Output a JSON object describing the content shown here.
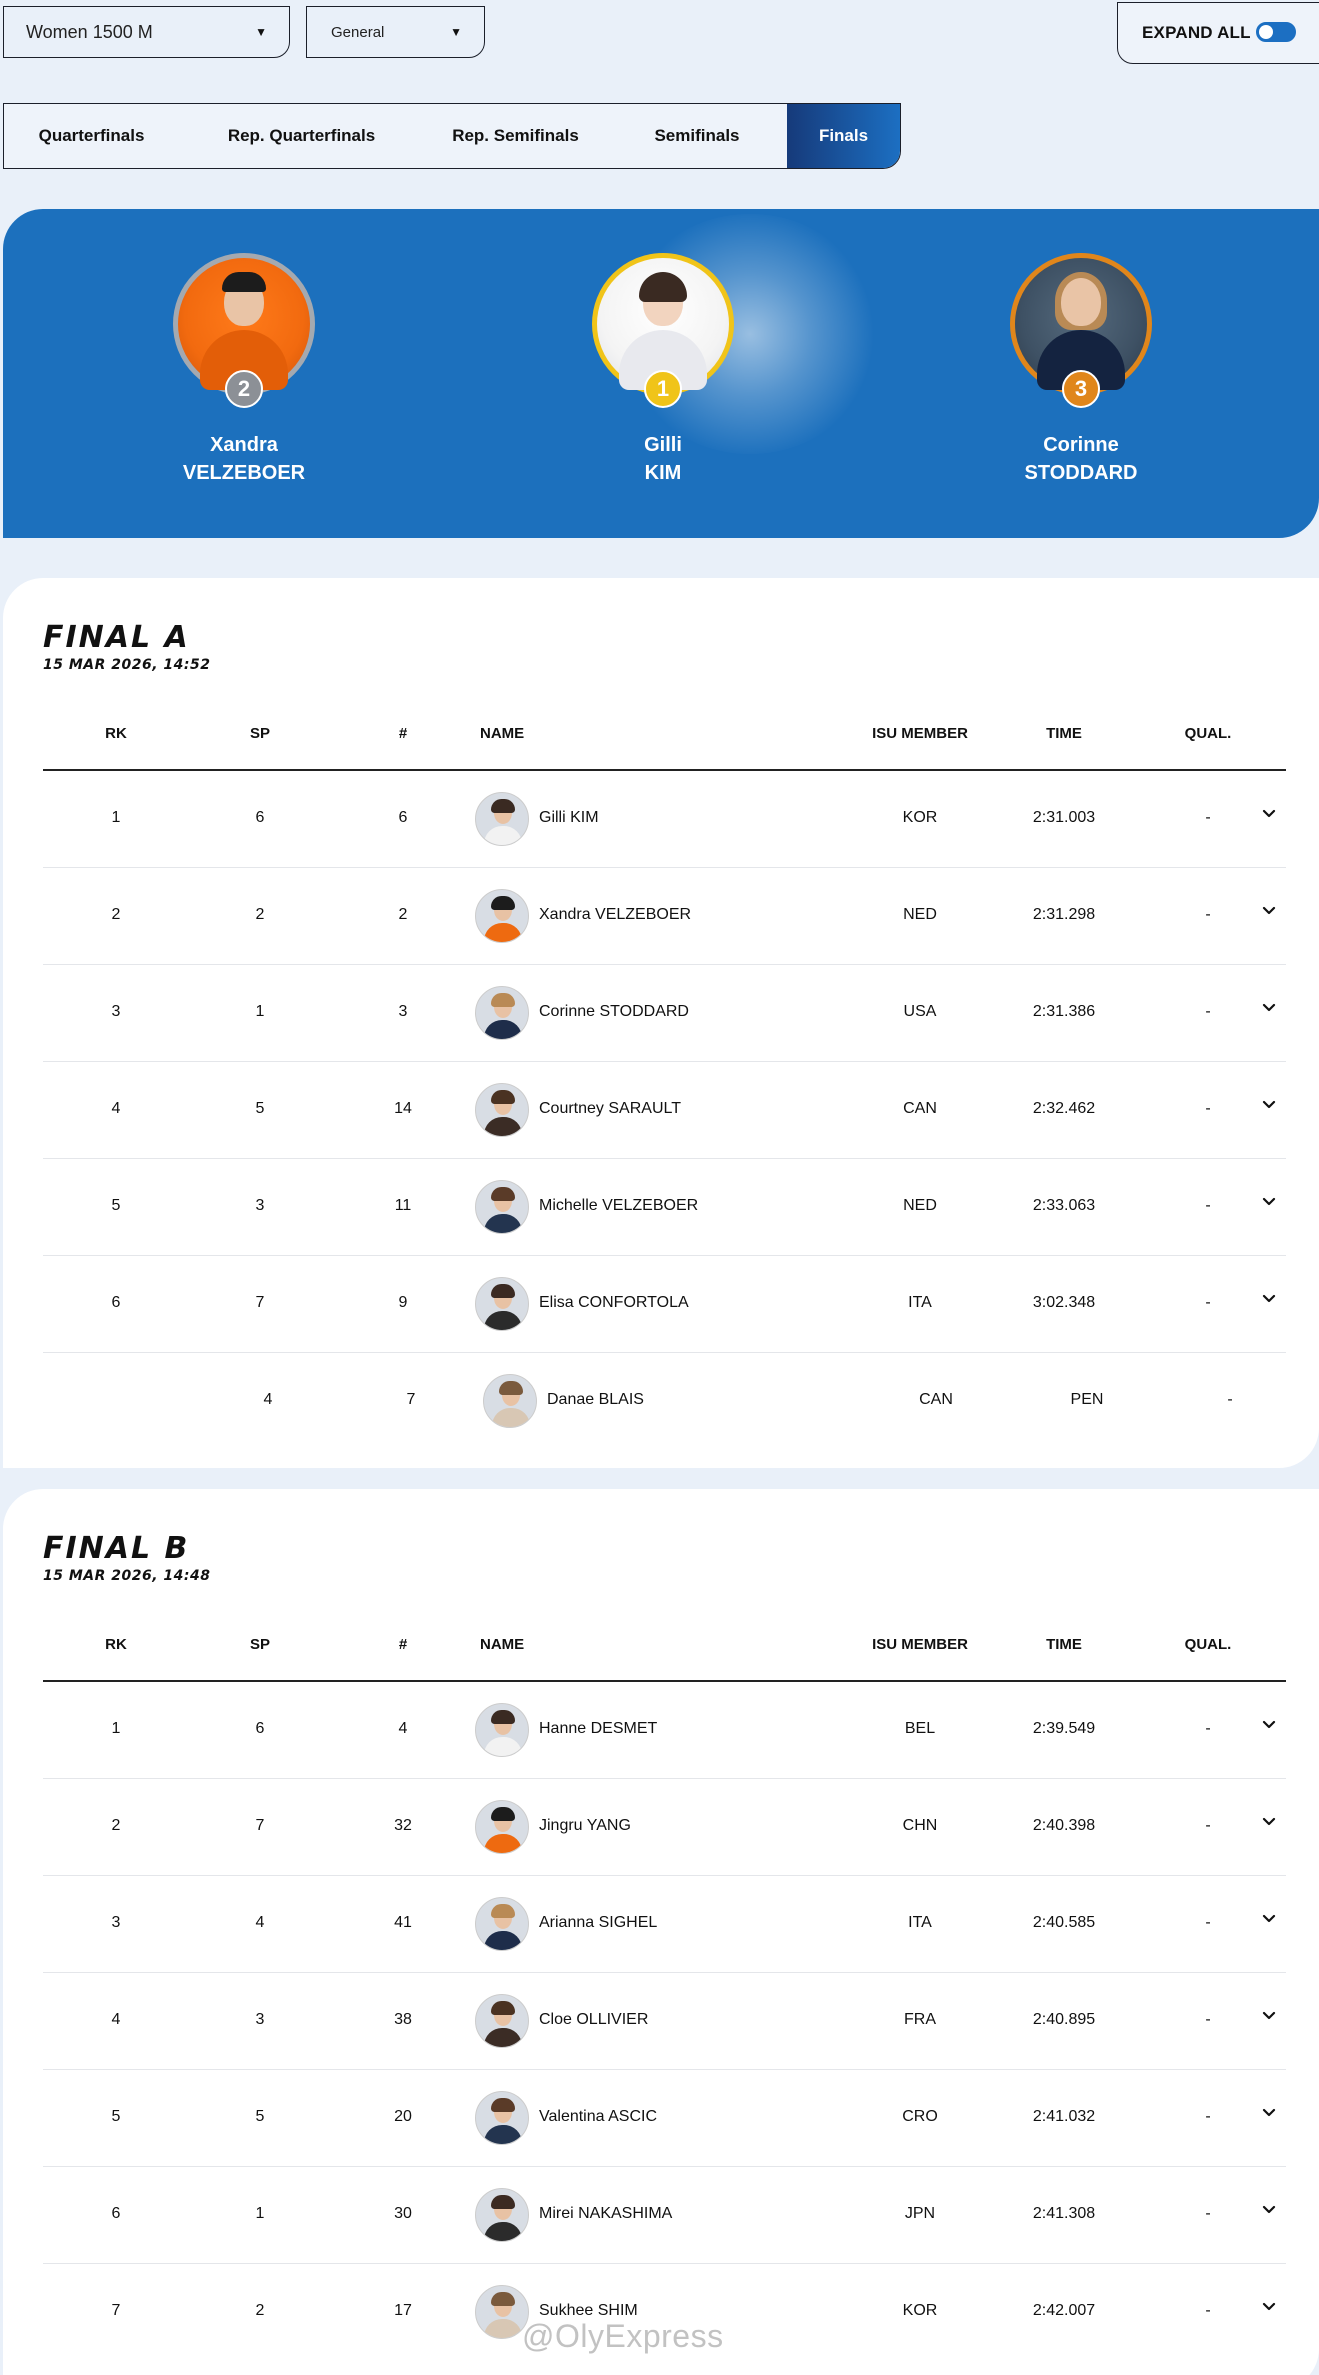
{
  "filters": {
    "event": "Women 1500 M",
    "category": "General",
    "expand_all": "EXPAND ALL"
  },
  "tabs": [
    "Quarterfinals",
    "Rep. Quarterfinals",
    "Rep. Semifinals",
    "Semifinals",
    "Finals"
  ],
  "active_tab": "Finals",
  "podium": [
    {
      "place": "2",
      "first": "Xandra",
      "last": "VELZEBOER"
    },
    {
      "place": "1",
      "first": "Gilli",
      "last": "KIM"
    },
    {
      "place": "3",
      "first": "Corinne",
      "last": "STODDARD"
    }
  ],
  "headers": {
    "rk": "RK",
    "sp": "SP",
    "no": "#",
    "name": "NAME",
    "isu": "ISU MEMBER",
    "time": "TIME",
    "qual": "QUAL."
  },
  "final_a": {
    "title": "FINAL A",
    "date": "15 MAR 2026, 14:52",
    "rows": [
      {
        "rk": "1",
        "sp": "6",
        "no": "6",
        "name": "Gilli KIM",
        "isu": "KOR",
        "time": "2:31.003",
        "qual": "-"
      },
      {
        "rk": "2",
        "sp": "2",
        "no": "2",
        "name": "Xandra VELZEBOER",
        "isu": "NED",
        "time": "2:31.298",
        "qual": "-"
      },
      {
        "rk": "3",
        "sp": "1",
        "no": "3",
        "name": "Corinne STODDARD",
        "isu": "USA",
        "time": "2:31.386",
        "qual": "-"
      },
      {
        "rk": "4",
        "sp": "5",
        "no": "14",
        "name": "Courtney SARAULT",
        "isu": "CAN",
        "time": "2:32.462",
        "qual": "-"
      },
      {
        "rk": "5",
        "sp": "3",
        "no": "11",
        "name": "Michelle VELZEBOER",
        "isu": "NED",
        "time": "2:33.063",
        "qual": "-"
      },
      {
        "rk": "6",
        "sp": "7",
        "no": "9",
        "name": "Elisa CONFORTOLA",
        "isu": "ITA",
        "time": "3:02.348",
        "qual": "-"
      },
      {
        "rk": "",
        "sp": "4",
        "no": "7",
        "name": "Danae BLAIS",
        "isu": "CAN",
        "time": "PEN",
        "qual": "-"
      }
    ]
  },
  "final_b": {
    "title": "FINAL B",
    "date": "15 MAR 2026, 14:48",
    "rows": [
      {
        "rk": "1",
        "sp": "6",
        "no": "4",
        "name": "Hanne DESMET",
        "isu": "BEL",
        "time": "2:39.549",
        "qual": "-"
      },
      {
        "rk": "2",
        "sp": "7",
        "no": "32",
        "name": "Jingru YANG",
        "isu": "CHN",
        "time": "2:40.398",
        "qual": "-"
      },
      {
        "rk": "3",
        "sp": "4",
        "no": "41",
        "name": "Arianna SIGHEL",
        "isu": "ITA",
        "time": "2:40.585",
        "qual": "-"
      },
      {
        "rk": "4",
        "sp": "3",
        "no": "38",
        "name": "Cloe OLLIVIER",
        "isu": "FRA",
        "time": "2:40.895",
        "qual": "-"
      },
      {
        "rk": "5",
        "sp": "5",
        "no": "20",
        "name": "Valentina ASCIC",
        "isu": "CRO",
        "time": "2:41.032",
        "qual": "-"
      },
      {
        "rk": "6",
        "sp": "1",
        "no": "30",
        "name": "Mirei NAKASHIMA",
        "isu": "JPN",
        "time": "2:41.308",
        "qual": "-"
      },
      {
        "rk": "7",
        "sp": "2",
        "no": "17",
        "name": "Sukhee SHIM",
        "isu": "KOR",
        "time": "2:42.007",
        "qual": "-"
      }
    ]
  },
  "watermark": "@OlyExpress",
  "icons": {
    "dropdown": "caret-down-icon",
    "row_expand": "chevron-down-icon",
    "toggle": "toggle-switch-icon"
  },
  "colors": {
    "brand_blue": "#1c70bd",
    "gold": "#f0c419",
    "silver": "#8c9096",
    "bronze": "#e0861b",
    "page_bg": "#e9f0f9"
  }
}
